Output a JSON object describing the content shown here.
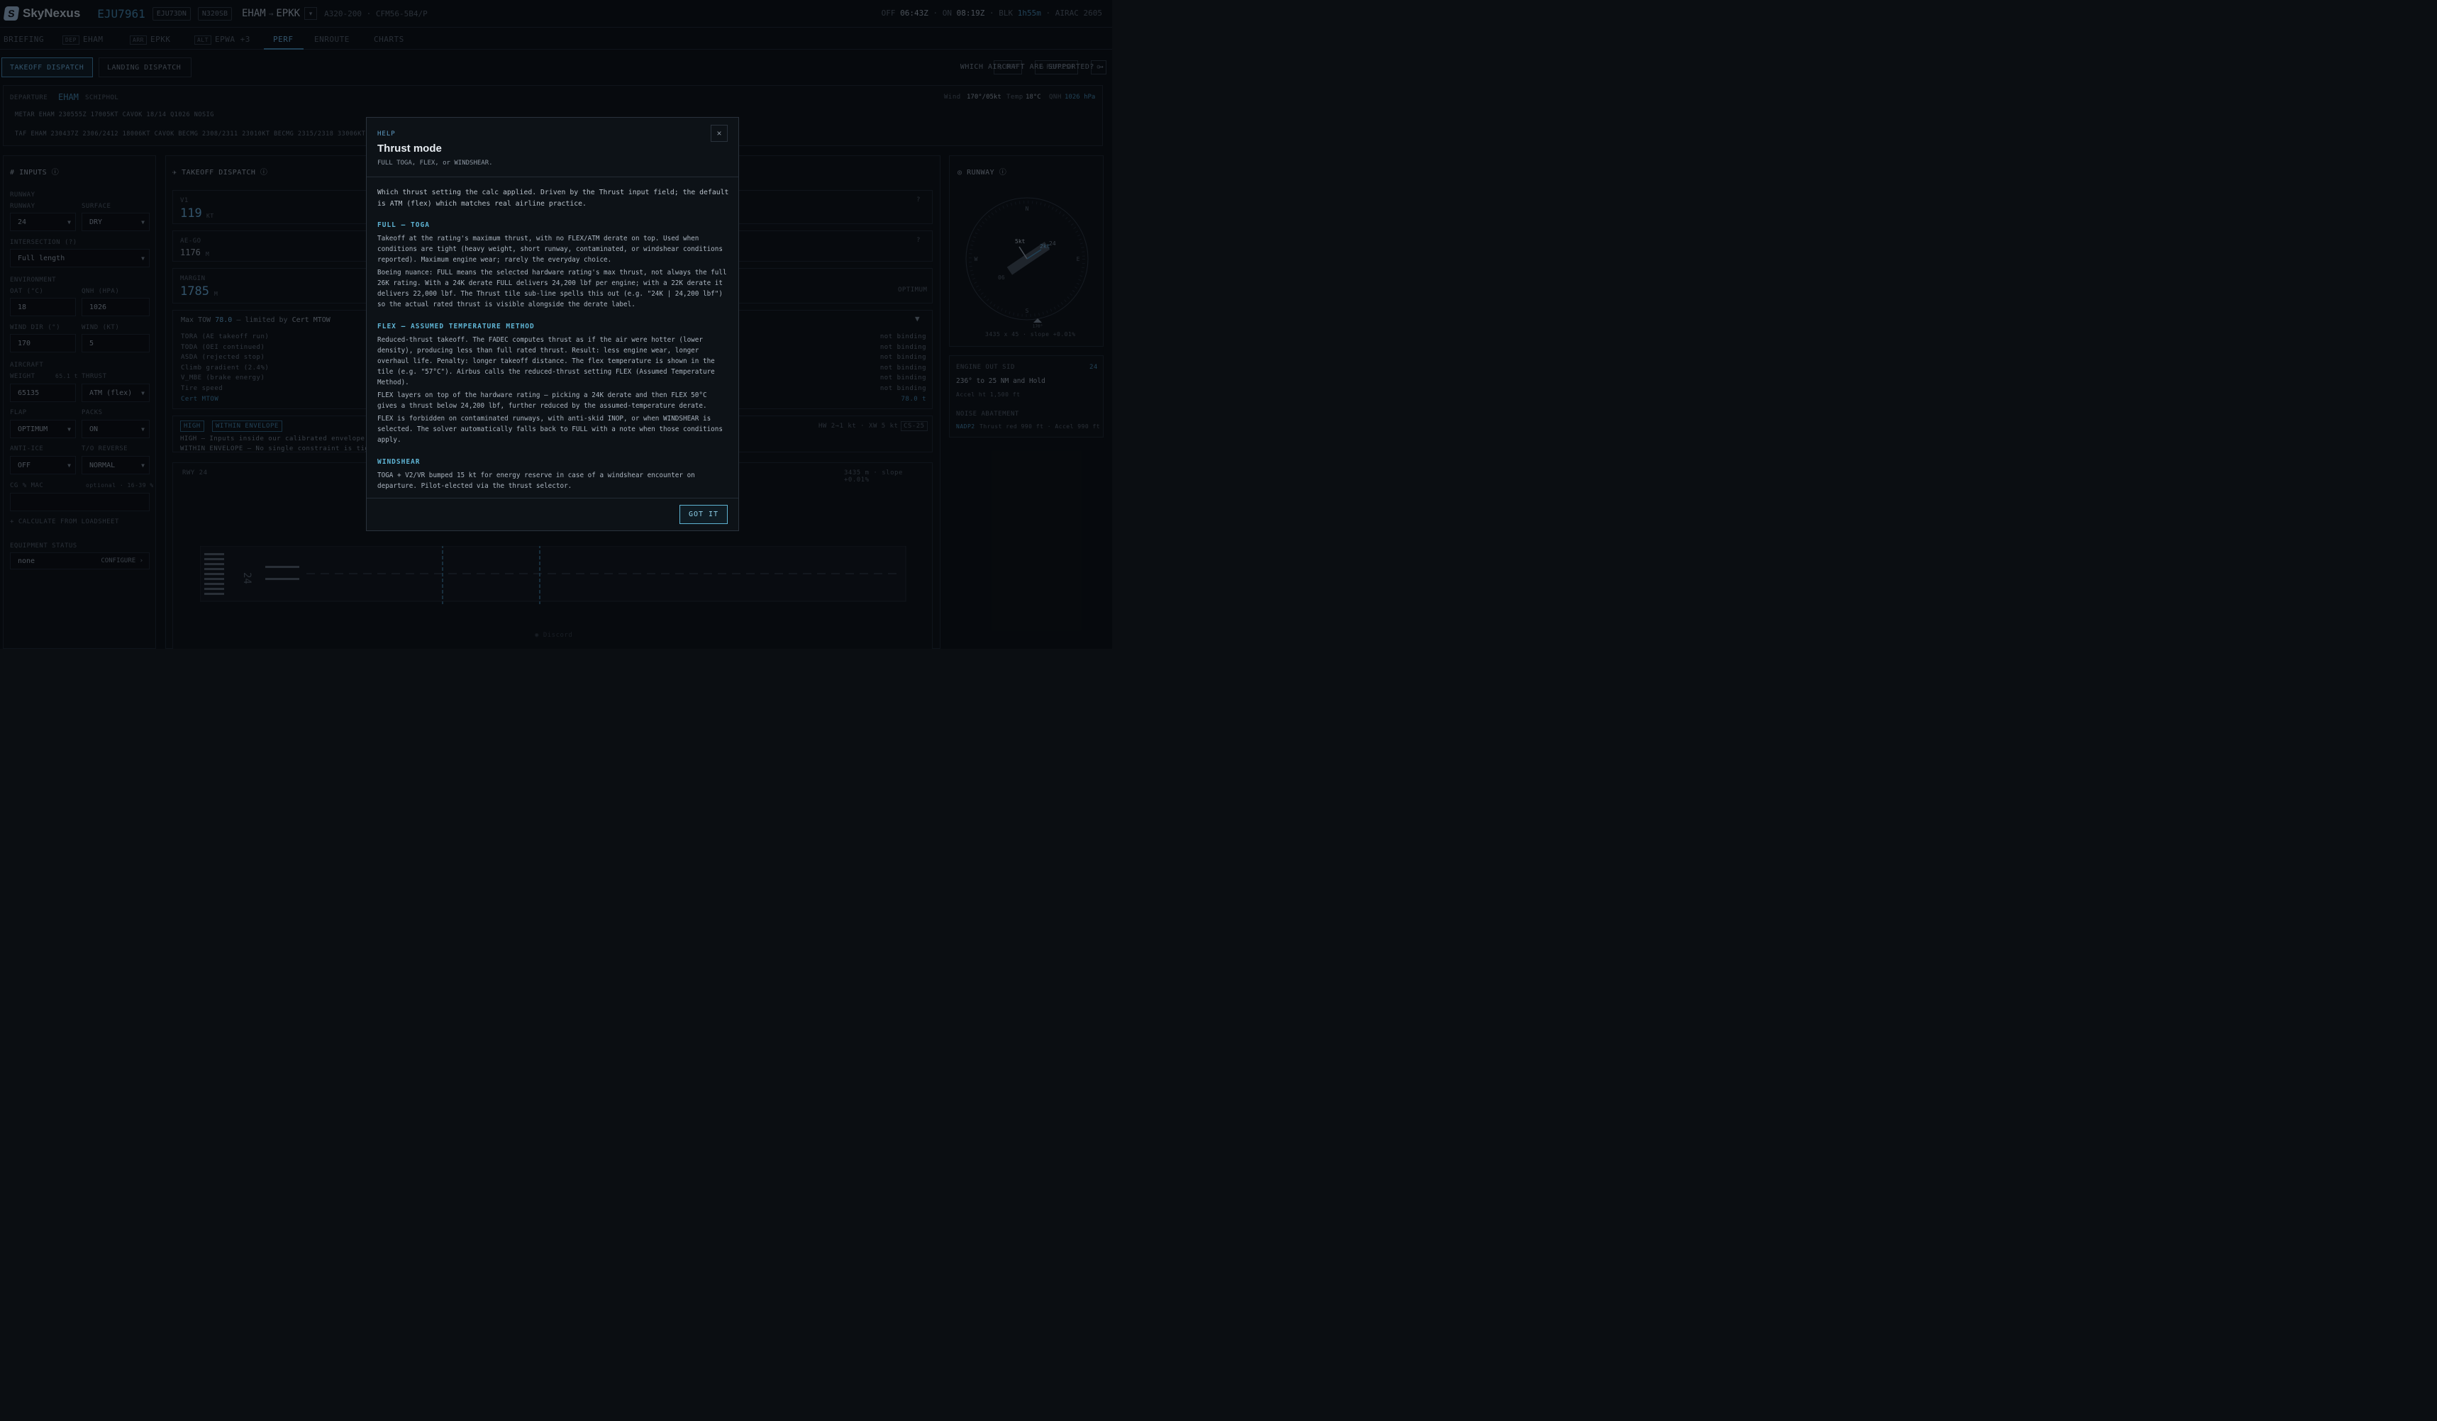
{
  "app": {
    "name": "SkyNexus",
    "flight_no": "EJU7961",
    "chip1": "EJU73DN",
    "chip2": "N320SB",
    "origin": "EHAM",
    "dest": "EPKK",
    "aircraft": "A320-200 · CFM56-5B4/P"
  },
  "times": {
    "off_label": "OFF",
    "off": "06:43Z",
    "on_label": "ON",
    "on": "08:19Z",
    "blk_label": "BLK",
    "blk": "1h55m",
    "airac": "AIRAC 2605"
  },
  "tabs": {
    "briefing": "BRIEFING",
    "dep_tag": "DEP",
    "dep": "EHAM",
    "arr_tag": "ARR",
    "arr": "EPKK",
    "alt_tag": "ALT",
    "alt": "EPWA +3",
    "perf": "PERF",
    "enroute": "ENROUTE",
    "charts": "CHARTS",
    "off_btn": "OFF",
    "refresh_btn": "REFRESH"
  },
  "modes": {
    "takeoff": "TAKEOFF DISPATCH",
    "landing": "LANDING DISPATCH",
    "which": "WHICH AIRCRAFT ARE SUPPORTED? →"
  },
  "departure": {
    "label": "DEPARTURE",
    "icao": "EHAM",
    "name": "SCHIPHOL",
    "wind_label": "Wind",
    "wind": "170°/05kt",
    "temp_label": "Temp",
    "temp": "18°C",
    "qnh_label": "QNH",
    "qnh": "1026 hPa",
    "metar": "METAR EHAM 230555Z 17005KT CAVOK 18/14 Q1026 NOSIG",
    "taf": "TAF EHAM 230437Z 2306/2412 18006KT CAVOK BECMG 2308/2311 23010KT BECMG 2315/2318 33006KT B"
  },
  "inputs": {
    "title": "INPUTS",
    "runway_sec": "RUNWAY",
    "runway_lbl": "RUNWAY",
    "runway": "24",
    "surface_lbl": "SURFACE",
    "surface": "DRY",
    "intersection_lbl": "INTERSECTION (?)",
    "intersection": "Full length",
    "env_sec": "ENVIRONMENT",
    "oat_lbl": "OAT (°C)",
    "oat": "18",
    "qnh_lbl": "QNH (HPA)",
    "qnh": "1026",
    "wdir_lbl": "WIND DIR (°)",
    "wdir": "170",
    "wkt_lbl": "WIND (KT)",
    "wkt": "5",
    "aircraft_sec": "AIRCRAFT",
    "weight_lbl": "WEIGHT",
    "weight_hint": "65.1 t",
    "thrust_lbl": "THRUST",
    "weight": "65135",
    "thrust": "ATM (flex)",
    "flap_lbl": "FLAP",
    "packs_lbl": "PACKS",
    "flap": "OPTIMUM",
    "packs": "ON",
    "antiice_lbl": "ANTI-ICE",
    "rev_lbl": "T/O REVERSE",
    "antiice": "OFF",
    "rev": "NORMAL",
    "cg_lbl": "CG % MAC",
    "cg_hint": "optional · 16-39 %",
    "calc": "+ CALCULATE FROM LOADSHEET",
    "equip_lbl": "EQUIPMENT STATUS",
    "equip": "none",
    "configure": "CONFIGURE ›"
  },
  "dispatch": {
    "title": "TAKEOFF DISPATCH",
    "v1_lbl": "V1",
    "v1": "119",
    "v1_unit": "KT",
    "aego_lbl": "AE-GO",
    "aego": "1176",
    "aego_unit": "M",
    "margin_lbl": "MARGIN",
    "margin": "1785",
    "margin_unit": "M",
    "optimum": "OPTIMUM",
    "maxtow_pre": "Max TOW",
    "maxtow": "78.0",
    "maxtow_mid": "— limited by",
    "maxtow_lim": "Cert MTOW",
    "limits": [
      {
        "name": "TORA (AE takeoff run)",
        "status": "not binding"
      },
      {
        "name": "TODA (OEI continued)",
        "status": "not binding"
      },
      {
        "name": "ASDA (rejected stop)",
        "status": "not binding"
      },
      {
        "name": "Climb gradient (2.4%)",
        "status": "not binding"
      },
      {
        "name": "V_MBE (brake energy)",
        "status": "not binding"
      },
      {
        "name": "Tire speed",
        "status": "not binding"
      },
      {
        "name": "Cert MTOW",
        "status": "78.0 t"
      }
    ],
    "badge_high": "HIGH",
    "badge_env": "WITHIN ENVELOPE",
    "note_high": "HIGH — Inputs inside our calibrated envelope. Nu",
    "note_env": "WITHIN ENVELOPE — No single constraint is tight",
    "wind_comp": "HW 2→1 kt · XW 5 kt",
    "cs": "CS-25",
    "rwy": "RWY 24",
    "rwy_info": "3435 m · slope +0.01%",
    "rwy_num": "24"
  },
  "runway_panel": {
    "title": "RUNWAY",
    "wind_kt": "5kt",
    "xw_kt": "2kt",
    "rwy_a": "24",
    "rwy_b": "06",
    "hdg": "170°",
    "dims": "3435 x 45 · slope +0.01%",
    "n": "N",
    "s": "S",
    "e": "E",
    "w": "W",
    "eosid_lbl": "ENGINE OUT SID",
    "eosid_rwy": "24",
    "eosid": "236° to 25 NM and Hold",
    "eosid_accel": "Accel ht 1,500 ft",
    "noise_lbl": "NOISE ABATEMENT",
    "nadp": "NADP2",
    "noise": "Thrust red 990 ft · Accel 990 ft"
  },
  "footer": {
    "discord": "Discord"
  },
  "modal": {
    "help": "HELP",
    "title": "Thrust mode",
    "subtitle": "FULL TOGA, FLEX, or WINDSHEAR.",
    "close": "×",
    "intro": "Which thrust setting the calc applied. Driven by the Thrust input field; the default is ATM (flex) which matches real airline practice.",
    "h1": "FULL — TOGA",
    "p1a": "Takeoff at the rating's maximum thrust, with no FLEX/ATM derate on top. Used when conditions are tight (heavy weight, short runway, contaminated, or windshear conditions reported). Maximum engine wear; rarely the everyday choice.",
    "p1b": "Boeing nuance: FULL means the selected hardware rating's max thrust, not always the full 26K rating. With a 24K derate FULL delivers 24,200 lbf per engine; with a 22K derate it delivers 22,000 lbf. The Thrust tile sub-line spells this out (e.g. \"24K | 24,200 lbf\") so the actual rated thrust is visible alongside the derate label.",
    "h2": "FLEX — ASSUMED TEMPERATURE METHOD",
    "p2a": "Reduced-thrust takeoff. The FADEC computes thrust as if the air were hotter (lower density), producing less than full rated thrust. Result: less engine wear, longer overhaul life. Penalty: longer takeoff distance. The flex temperature is shown in the tile (e.g. \"57°C\"). Airbus calls the reduced-thrust setting FLEX (Assumed Temperature Method).",
    "p2b": "FLEX layers on top of the hardware rating — picking a 24K derate and then FLEX 50°C gives a thrust below 24,200 lbf, further reduced by the assumed-temperature derate.",
    "p2c": "FLEX is forbidden on contaminated runways, with anti-skid INOP, or when WINDSHEAR is selected. The solver automatically falls back to FULL with a note when those conditions apply.",
    "h3": "WINDSHEAR",
    "p3": "TOGA + V2/VR bumped 15 kt for energy reserve in case of a windshear encounter on departure. Pilot-elected via the thrust selector.",
    "gotit": "GOT IT"
  }
}
